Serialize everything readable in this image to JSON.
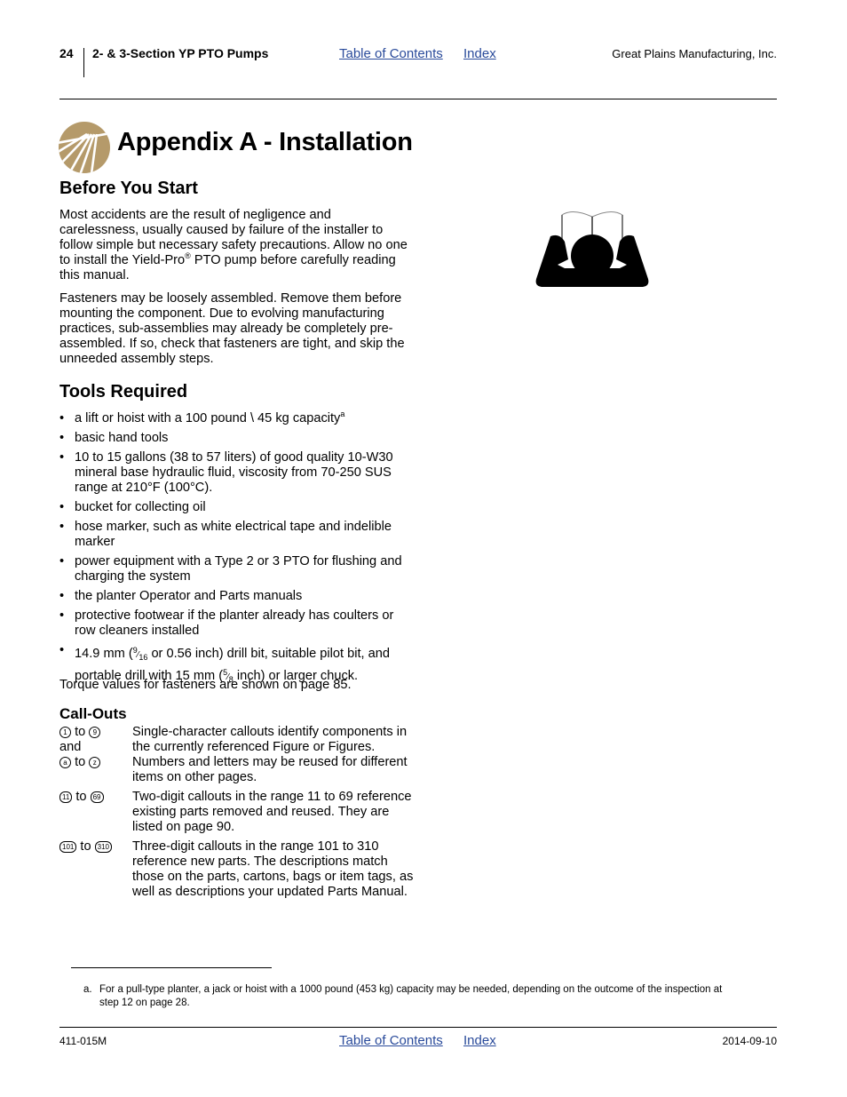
{
  "header": {
    "page_number": "24",
    "section_title": "2- & 3-Section YP PTO Pumps",
    "toc_link": "Table of Contents",
    "index_link": "Index",
    "company": "Great Plains Manufacturing, Inc."
  },
  "colors": {
    "link": "#2a4b9b",
    "logo_gold": "#b59a6a"
  },
  "icons": {
    "logo": "great-plains-logo-icon",
    "reader": "read-manual-icon"
  },
  "appendix_title": "Appendix A - Installation",
  "before_you_start": {
    "heading": "Before You Start",
    "para1_a": "Most accidents are the result of negligence and carelessness, usually caused by failure of the installer to follow simple but necessary safety precautions. Allow no one to install the Yield-Pro",
    "para1_reg": "®",
    "para1_b": " PTO pump before carefully reading this manual.",
    "para2": "Fasteners may be loosely assembled. Remove them before mounting the component. Due to evolving manufacturing practices, sub-assemblies may already be completely pre-assembled. If so, check that fasteners are tight, and skip the unneeded assembly steps."
  },
  "tools_required": {
    "heading": "Tools Required",
    "bullet": "•",
    "items": [
      {
        "text": "a lift or hoist with a 100 pound \\ 45 kg capacity",
        "footnote_ref": "a"
      },
      {
        "text": "basic hand tools"
      },
      {
        "text": "10 to 15 gallons (38 to 57 liters) of good quality 10-W30 mineral base hydraulic fluid, viscosity from 70-250 SUS range at 210°F (100°C)."
      },
      {
        "text": "bucket for collecting oil"
      },
      {
        "text": "hose marker, such as white electrical tape and indelible marker"
      },
      {
        "text": "power equipment with a Type 2 or 3 PTO for flushing and charging the system"
      },
      {
        "text": "the planter Operator and Parts manuals"
      },
      {
        "text": "protective footwear if the planter already has coulters or row cleaners installed"
      },
      {
        "text_a": "14.9 mm (",
        "frac1_num": "9",
        "frac1_den": "16",
        "text_b": " or 0.56 inch) drill bit, suitable pilot bit, and portable drill with 15 mm (",
        "frac2_num": "5",
        "frac2_den": "8",
        "text_c": " inch) or larger chuck."
      }
    ],
    "torque_note": "Torque values for fasteners are shown on page 85."
  },
  "callouts": {
    "heading": "Call-Outs",
    "rows": [
      {
        "key_start": "1",
        "key_to": "to",
        "key_end": "9",
        "key_and": "and",
        "key2_start": "a",
        "key2_end": "z",
        "description": "Single-character callouts identify components in the currently referenced Figure or Figures. Numbers and letters may be reused for different items on other pages."
      },
      {
        "key_start": "11",
        "key_to": "to",
        "key_end": "69",
        "description": "Two-digit callouts in the range 11 to 69 reference existing parts removed and reused. They are listed on page 90."
      },
      {
        "key_start": "101",
        "key_to": "to",
        "key_end": "310",
        "description": "Three-digit callouts in the range 101 to 310 reference new parts. The descriptions match those on the parts, cartons, bags or item tags, as well as descriptions your updated Parts Manual."
      }
    ]
  },
  "footnote": {
    "mark": "a.",
    "text": "For a pull-type planter, a jack or hoist with a 1000 pound (453 kg) capacity may be needed, depending on the outcome of the inspection at step 12 on page 28."
  },
  "footer": {
    "doc_number": "411-015M",
    "toc_link": "Table of Contents",
    "index_link": "Index",
    "date": "2014-09-10"
  }
}
